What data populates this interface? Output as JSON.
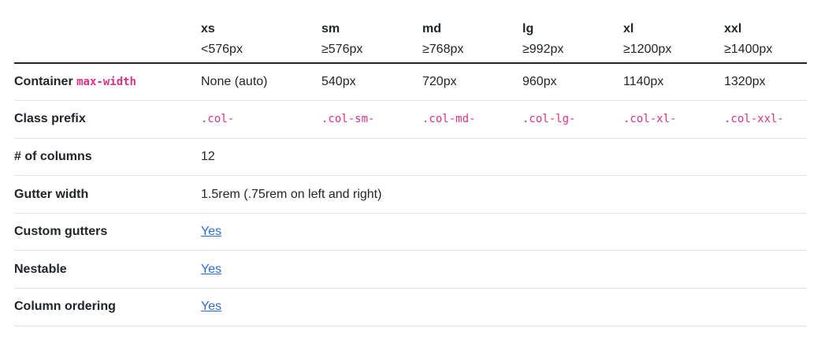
{
  "header": {
    "breakpoints": [
      {
        "name": "xs",
        "size": "<576px"
      },
      {
        "name": "sm",
        "size": "≥576px"
      },
      {
        "name": "md",
        "size": "≥768px"
      },
      {
        "name": "lg",
        "size": "≥992px"
      },
      {
        "name": "xl",
        "size": "≥1200px"
      },
      {
        "name": "xxl",
        "size": "≥1400px"
      }
    ]
  },
  "rows": {
    "container": {
      "label": "Container ",
      "code": "max-width",
      "values": [
        "None (auto)",
        "540px",
        "720px",
        "960px",
        "1140px",
        "1320px"
      ]
    },
    "class_prefix": {
      "label": "Class prefix",
      "values": [
        ".col-",
        ".col-sm-",
        ".col-md-",
        ".col-lg-",
        ".col-xl-",
        ".col-xxl-"
      ]
    },
    "columns": {
      "label": "# of columns",
      "value": "12"
    },
    "gutter": {
      "label": "Gutter width",
      "value": "1.5rem (.75rem on left and right)"
    },
    "custom_gutters": {
      "label": "Custom gutters",
      "link": "Yes"
    },
    "nestable": {
      "label": "Nestable",
      "link": "Yes"
    },
    "ordering": {
      "label": "Column ordering",
      "link": "Yes"
    }
  },
  "colors": {
    "text": "#212529",
    "code": "#d63384",
    "link": "#2a6cd6",
    "border": "#dee2e6"
  }
}
